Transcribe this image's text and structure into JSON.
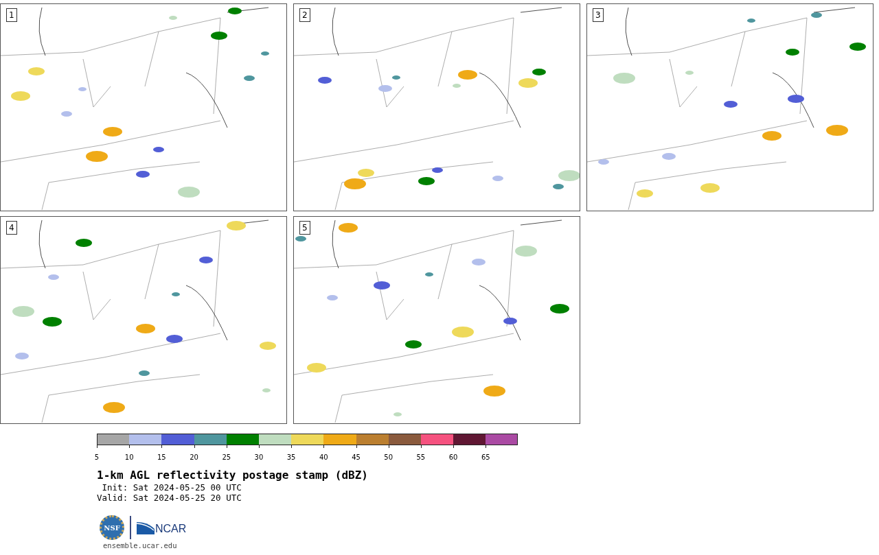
{
  "panels": [
    {
      "label": "1"
    },
    {
      "label": "2"
    },
    {
      "label": "3"
    },
    {
      "label": "4"
    },
    {
      "label": "5"
    }
  ],
  "colorbar": {
    "segments": [
      {
        "color": "#a6a6a6",
        "tick": "5"
      },
      {
        "color": "#b3bfec",
        "tick": "10"
      },
      {
        "color": "#525ed6",
        "tick": "15"
      },
      {
        "color": "#4f969e",
        "tick": "20"
      },
      {
        "color": "#008000",
        "tick": "25"
      },
      {
        "color": "#bfddbf",
        "tick": "30"
      },
      {
        "color": "#eed95a",
        "tick": "35"
      },
      {
        "color": "#efaa17",
        "tick": "40"
      },
      {
        "color": "#bb7f30",
        "tick": "45"
      },
      {
        "color": "#8a5a3d",
        "tick": "50"
      },
      {
        "color": "#f5527f",
        "tick": "55"
      },
      {
        "color": "#601733",
        "tick": "60"
      },
      {
        "color": "#aa4aa3",
        "tick": "65"
      }
    ]
  },
  "title": "1-km AGL reflectivity postage stamp (dBZ)",
  "init": " Init: Sat 2024-05-25 00 UTC",
  "valid": "Valid: Sat 2024-05-25 20 UTC",
  "logo": {
    "seal": "NSF",
    "wordmark": "NCAR"
  },
  "footer": "ensemble.ucar.edu"
}
